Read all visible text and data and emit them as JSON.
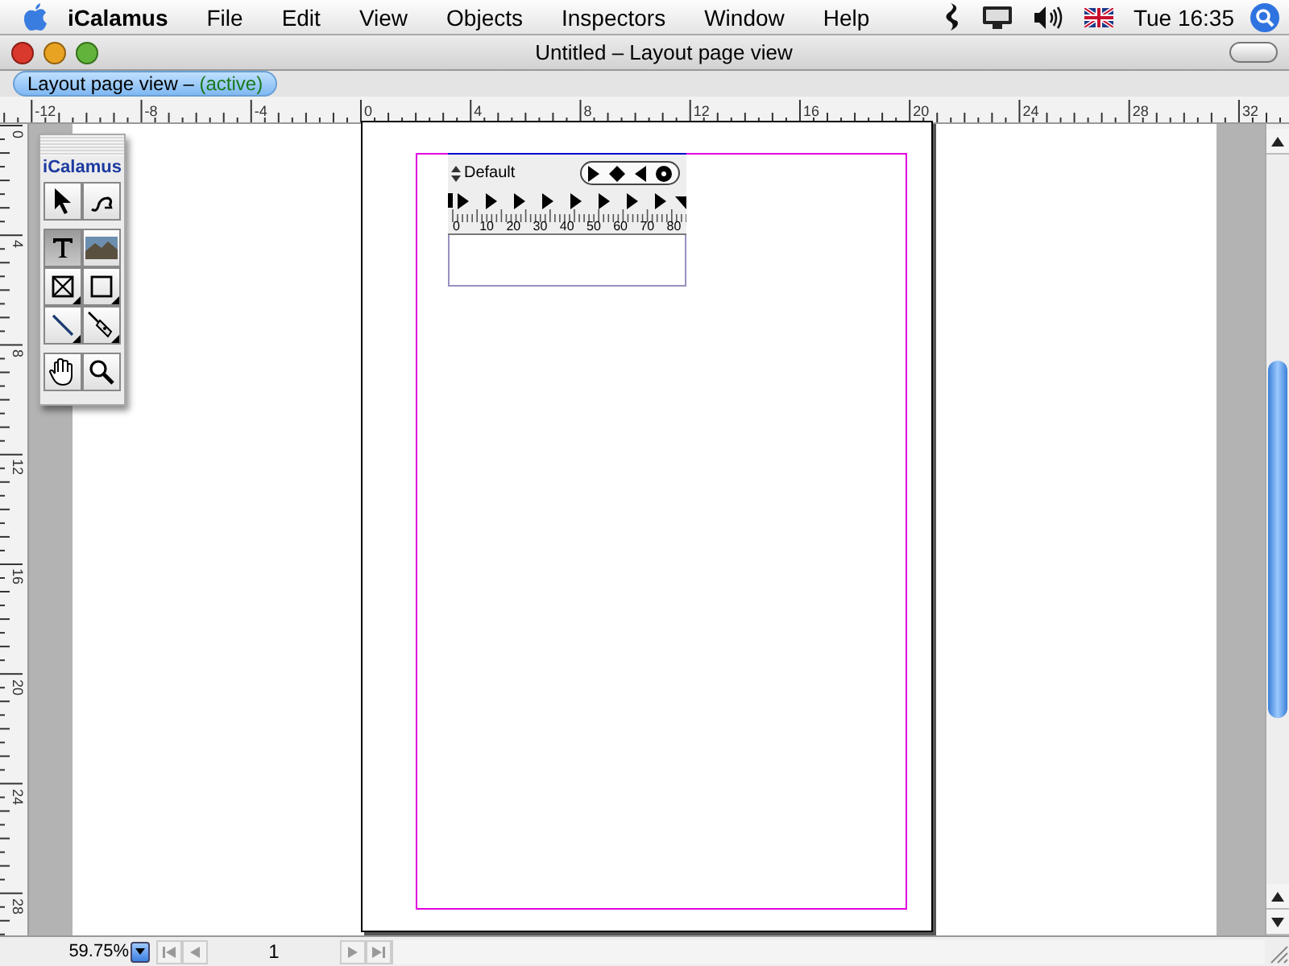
{
  "menubar": {
    "app": "iCalamus",
    "menus": [
      "File",
      "Edit",
      "View",
      "Objects",
      "Inspectors",
      "Window",
      "Help"
    ],
    "clock": "Tue 16:35"
  },
  "window": {
    "title": "Untitled – Layout page view"
  },
  "tab": {
    "label": "Layout page view –",
    "state": "(active)",
    "selected": true
  },
  "hruler": {
    "labels": [
      "-12",
      "-8",
      "-4",
      "0",
      "4",
      "8",
      "12",
      "16",
      "20",
      "24",
      "28",
      "32"
    ]
  },
  "vruler": {
    "labels": [
      "0",
      "4",
      "8",
      "12",
      "16",
      "20",
      "24",
      "28"
    ]
  },
  "toolbox": {
    "title": "iCalamus",
    "groups": [
      {
        "tools": [
          {
            "selected": false,
            "flyout": false
          },
          {
            "selected": false,
            "flyout": false
          }
        ]
      },
      {
        "tools": [
          {
            "selected": true,
            "flyout": false
          },
          {
            "selected": false,
            "flyout": false
          },
          {
            "selected": false,
            "flyout": true
          },
          {
            "selected": false,
            "flyout": true
          },
          {
            "selected": false,
            "flyout": true
          },
          {
            "selected": false,
            "flyout": true
          }
        ]
      },
      {
        "tools": [
          {
            "selected": false,
            "flyout": false
          },
          {
            "selected": false,
            "flyout": false
          }
        ]
      }
    ]
  },
  "text_frame": {
    "style": "Default",
    "tab_labels": [
      "0",
      "10",
      "20",
      "30",
      "40",
      "50",
      "60",
      "70",
      "80"
    ]
  },
  "footer": {
    "zoom": "59.75%",
    "page": "1"
  }
}
